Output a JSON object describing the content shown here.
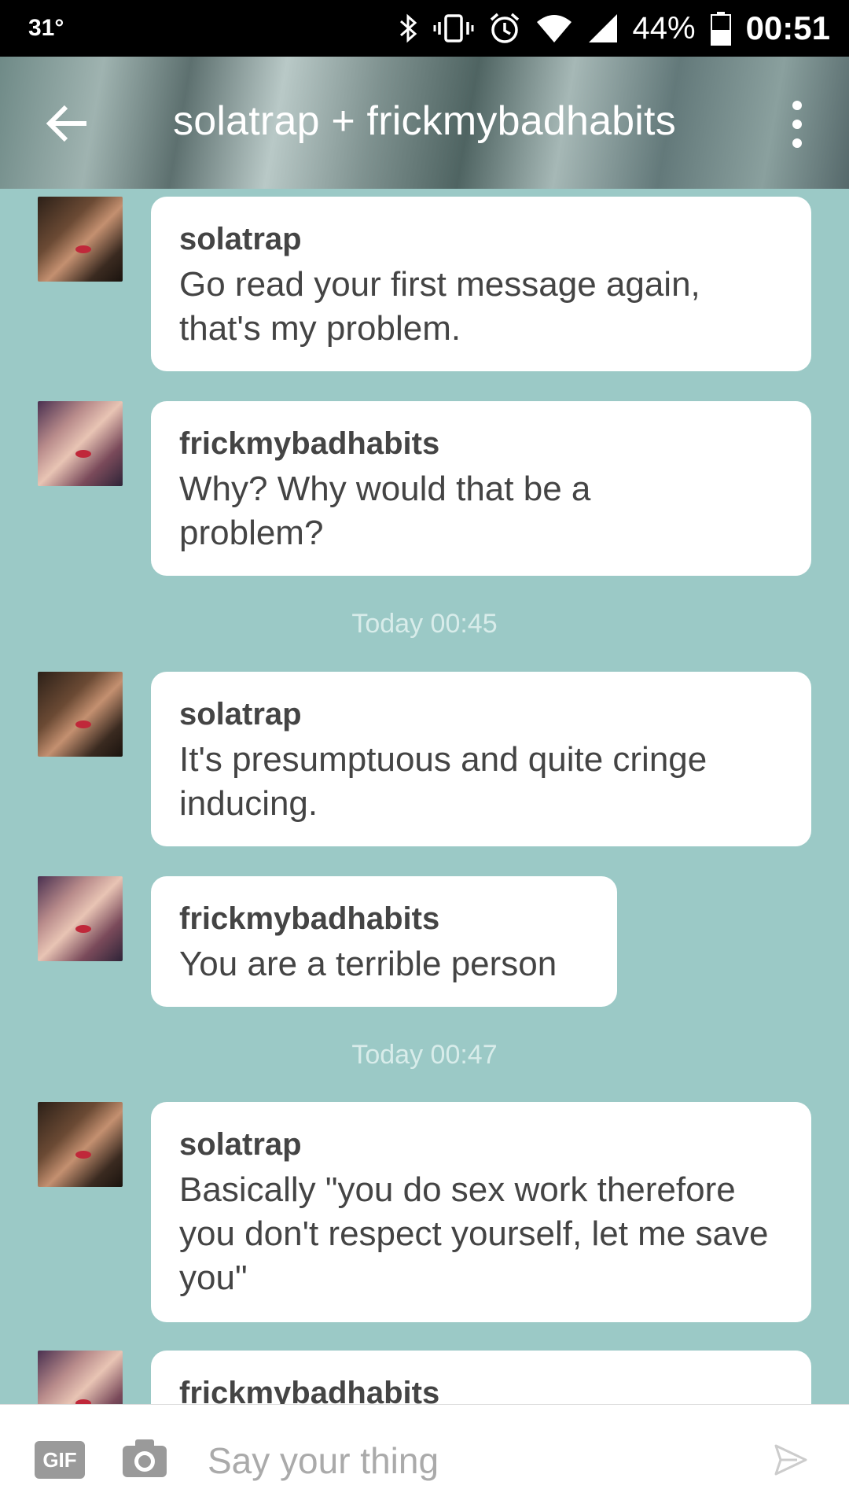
{
  "status_bar": {
    "temperature": "31°",
    "battery_percent": "44%",
    "time": "00:51"
  },
  "header": {
    "title": "solatrap + frickmybadhabits",
    "back_icon": "arrow-left-icon",
    "menu_icon": "more-vert-icon"
  },
  "messages": [
    {
      "author": "solatrap",
      "text": "Go read your first message again, that's my problem.",
      "avatar": "solatrap-avatar"
    },
    {
      "author": "frickmybadhabits",
      "text": "Why? Why would that be a problem?",
      "avatar": "frickmybadhabits-avatar"
    },
    {
      "author": "solatrap",
      "text": "It's presumptuous and quite cringe inducing.",
      "avatar": "solatrap-avatar"
    },
    {
      "author": "frickmybadhabits",
      "text": "You are a terrible person",
      "avatar": "frickmybadhabits-avatar"
    },
    {
      "author": "solatrap",
      "text": "Basically \"you do sex work therefore you don't respect yourself, let me save you\"",
      "avatar": "solatrap-avatar"
    },
    {
      "author": "frickmybadhabits",
      "text": "",
      "avatar": "frickmybadhabits-avatar"
    }
  ],
  "timestamps": [
    "Today 00:45",
    "Today 00:47"
  ],
  "composer": {
    "gif_label": "GIF",
    "placeholder": "Say your thing",
    "camera_icon": "camera-icon",
    "send_icon": "send-icon"
  },
  "colors": {
    "chat_background": "#9bc9c6",
    "bubble": "#ffffff",
    "status_bar": "#000000"
  }
}
